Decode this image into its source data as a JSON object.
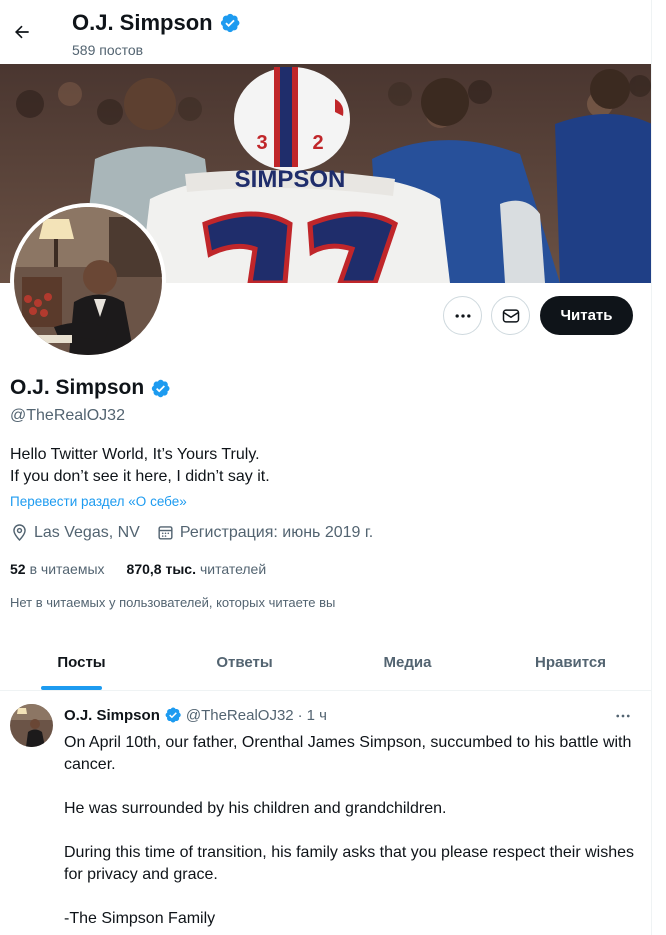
{
  "header": {
    "name": "O.J. Simpson",
    "post_count": "589 постов"
  },
  "banner": {
    "jersey_name": "SIMPSON",
    "jersey_number": "32",
    "helmet_number": "32"
  },
  "actions": {
    "follow_label": "Читать"
  },
  "profile": {
    "name": "O.J. Simpson",
    "handle": "@TheRealOJ32",
    "bio_line1": "Hello Twitter World, It’s Yours Truly.",
    "bio_line2": "If you don’t see it here, I didn’t say it.",
    "translate_link": "Перевести раздел «О себе»",
    "location": "Las Vegas, NV",
    "joined": "Регистрация: июнь 2019 г.",
    "following_count": "52",
    "following_label": "в читаемых",
    "followers_count": "870,8 тыс.",
    "followers_label": "читателей",
    "followed_by_note": "Нет в читаемых у пользователей, которых читаете вы"
  },
  "tabs": [
    {
      "label": "Посты",
      "active": true
    },
    {
      "label": "Ответы",
      "active": false
    },
    {
      "label": "Медиа",
      "active": false
    },
    {
      "label": "Нравится",
      "active": false
    }
  ],
  "tweet": {
    "author": "O.J. Simpson",
    "handle": "@TheRealOJ32",
    "separator": "·",
    "time": "1 ч",
    "paragraphs": [
      "On April 10th, our father, Orenthal James Simpson, succumbed to his battle with cancer.",
      "He was surrounded by his children and grandchildren.",
      "During this time of transition, his family asks that you please respect their wishes for privacy and grace.",
      "-The Simpson Family"
    ]
  },
  "colors": {
    "accent": "#1d9bf0",
    "text": "#0f1419",
    "secondary": "#536471",
    "verified": "#1d9bf0"
  }
}
